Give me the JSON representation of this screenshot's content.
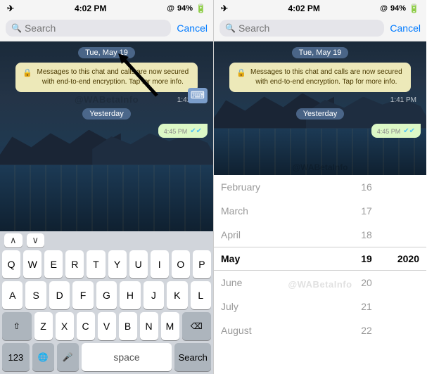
{
  "statusBar": {
    "time": "4:02 PM",
    "battery": "94%",
    "batteryIcon": "🔋"
  },
  "searchBar": {
    "placeholder": "Search",
    "cancelLabel": "Cancel"
  },
  "chat": {
    "dateBadge": "Tue, May 19",
    "encryptionMsg": "Messages to this chat and calls are now secured with end-to-end encryption. Tap for more info.",
    "time1": "1:41 PM",
    "yesterdayBadge": "Yesterday",
    "time2": "4:45 PM"
  },
  "keyboard": {
    "navUp": "∧",
    "navDown": "∨",
    "row1": [
      "Q",
      "W",
      "E",
      "R",
      "T",
      "Y",
      "U",
      "I",
      "O",
      "P"
    ],
    "row2": [
      "A",
      "S",
      "D",
      "F",
      "G",
      "H",
      "J",
      "K",
      "L"
    ],
    "row3": [
      "Z",
      "X",
      "C",
      "V",
      "B",
      "N",
      "M"
    ],
    "numLabel": "123",
    "globeLabel": "🌐",
    "micLabel": "🎤",
    "spaceLabel": "space",
    "searchLabel": "Search",
    "deleteLabel": "⌫",
    "shiftLabel": "⇧"
  },
  "datePicker": {
    "months": [
      {
        "name": "February",
        "day": "16",
        "year": ""
      },
      {
        "name": "March",
        "day": "17",
        "year": ""
      },
      {
        "name": "April",
        "day": "18",
        "year": ""
      },
      {
        "name": "May",
        "day": "19",
        "year": "2020",
        "selected": true
      },
      {
        "name": "June",
        "day": "20",
        "year": ""
      },
      {
        "name": "July",
        "day": "21",
        "year": ""
      },
      {
        "name": "August",
        "day": "22",
        "year": ""
      }
    ]
  },
  "watermark": "@WABetaInfo"
}
